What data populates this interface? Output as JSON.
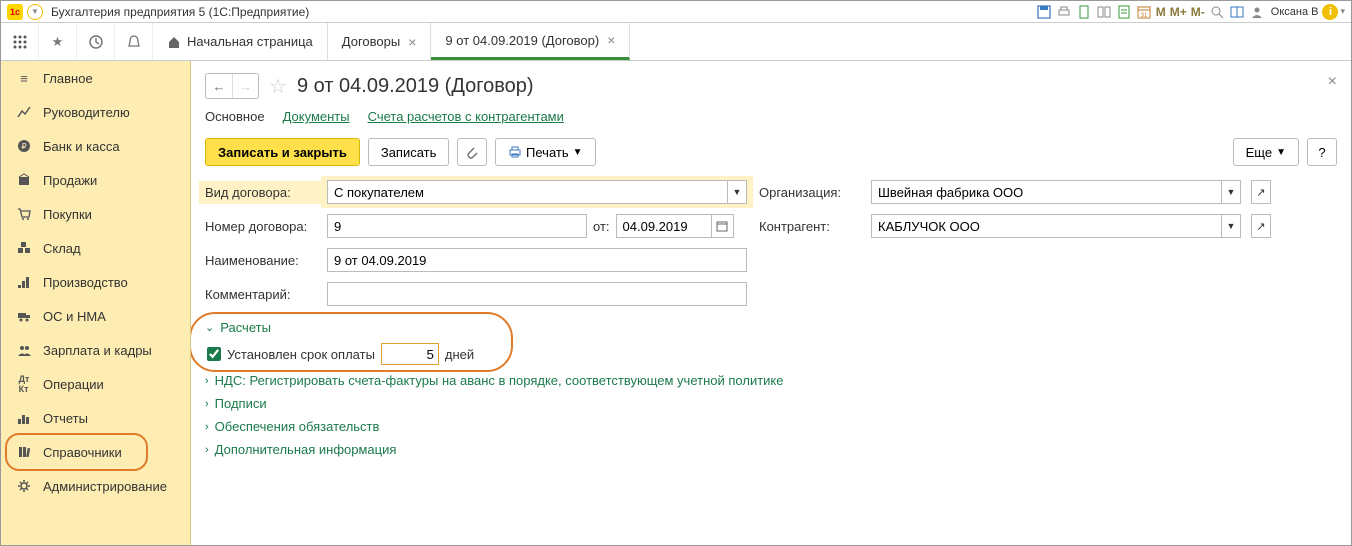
{
  "titlebar": {
    "app_title": "Бухгалтерия предприятия 5   (1С:Предприятие)",
    "mem_buttons": [
      "M",
      "M+",
      "M-"
    ],
    "username": "Оксана В"
  },
  "toolbar_tabs": {
    "home": "Начальная страница",
    "t1": "Договоры",
    "t2": "9 от 04.09.2019 (Договор)"
  },
  "sidebar": {
    "items": [
      {
        "label": "Главное"
      },
      {
        "label": "Руководителю"
      },
      {
        "label": "Банк и касса"
      },
      {
        "label": "Продажи"
      },
      {
        "label": "Покупки"
      },
      {
        "label": "Склад"
      },
      {
        "label": "Производство"
      },
      {
        "label": "ОС и НМА"
      },
      {
        "label": "Зарплата и кадры"
      },
      {
        "label": "Операции"
      },
      {
        "label": "Отчеты"
      },
      {
        "label": "Справочники"
      },
      {
        "label": "Администрирование"
      }
    ]
  },
  "page": {
    "title": "9 от 04.09.2019 (Договор)",
    "subnav": {
      "main": "Основное",
      "docs": "Документы",
      "accounts": "Счета расчетов с контрагентами"
    },
    "actions": {
      "save_close": "Записать и закрыть",
      "save": "Записать",
      "print": "Печать",
      "more": "Еще",
      "help": "?"
    },
    "fields": {
      "contract_type_label": "Вид договора:",
      "contract_type_value": "С покупателем",
      "org_label": "Организация:",
      "org_value": "Швейная фабрика ООО",
      "number_label": "Номер договора:",
      "number_value": "9",
      "from_label": "от:",
      "date_value": "04.09.2019",
      "counterparty_label": "Контрагент:",
      "counterparty_value": "КАБЛУЧОК ООО",
      "name_label": "Наименование:",
      "name_value": "9 от 04.09.2019",
      "comment_label": "Комментарий:",
      "comment_value": ""
    },
    "sections": {
      "calc": "Расчеты",
      "payment_set": "Установлен срок оплаты",
      "payment_days": "5",
      "days_suffix": "дней",
      "vat": "НДС: Регистрировать счета-фактуры на аванс в порядке, соответствующем учетной политике",
      "signs": "Подписи",
      "guarantees": "Обеспечения обязательств",
      "addinfo": "Дополнительная информация"
    }
  }
}
